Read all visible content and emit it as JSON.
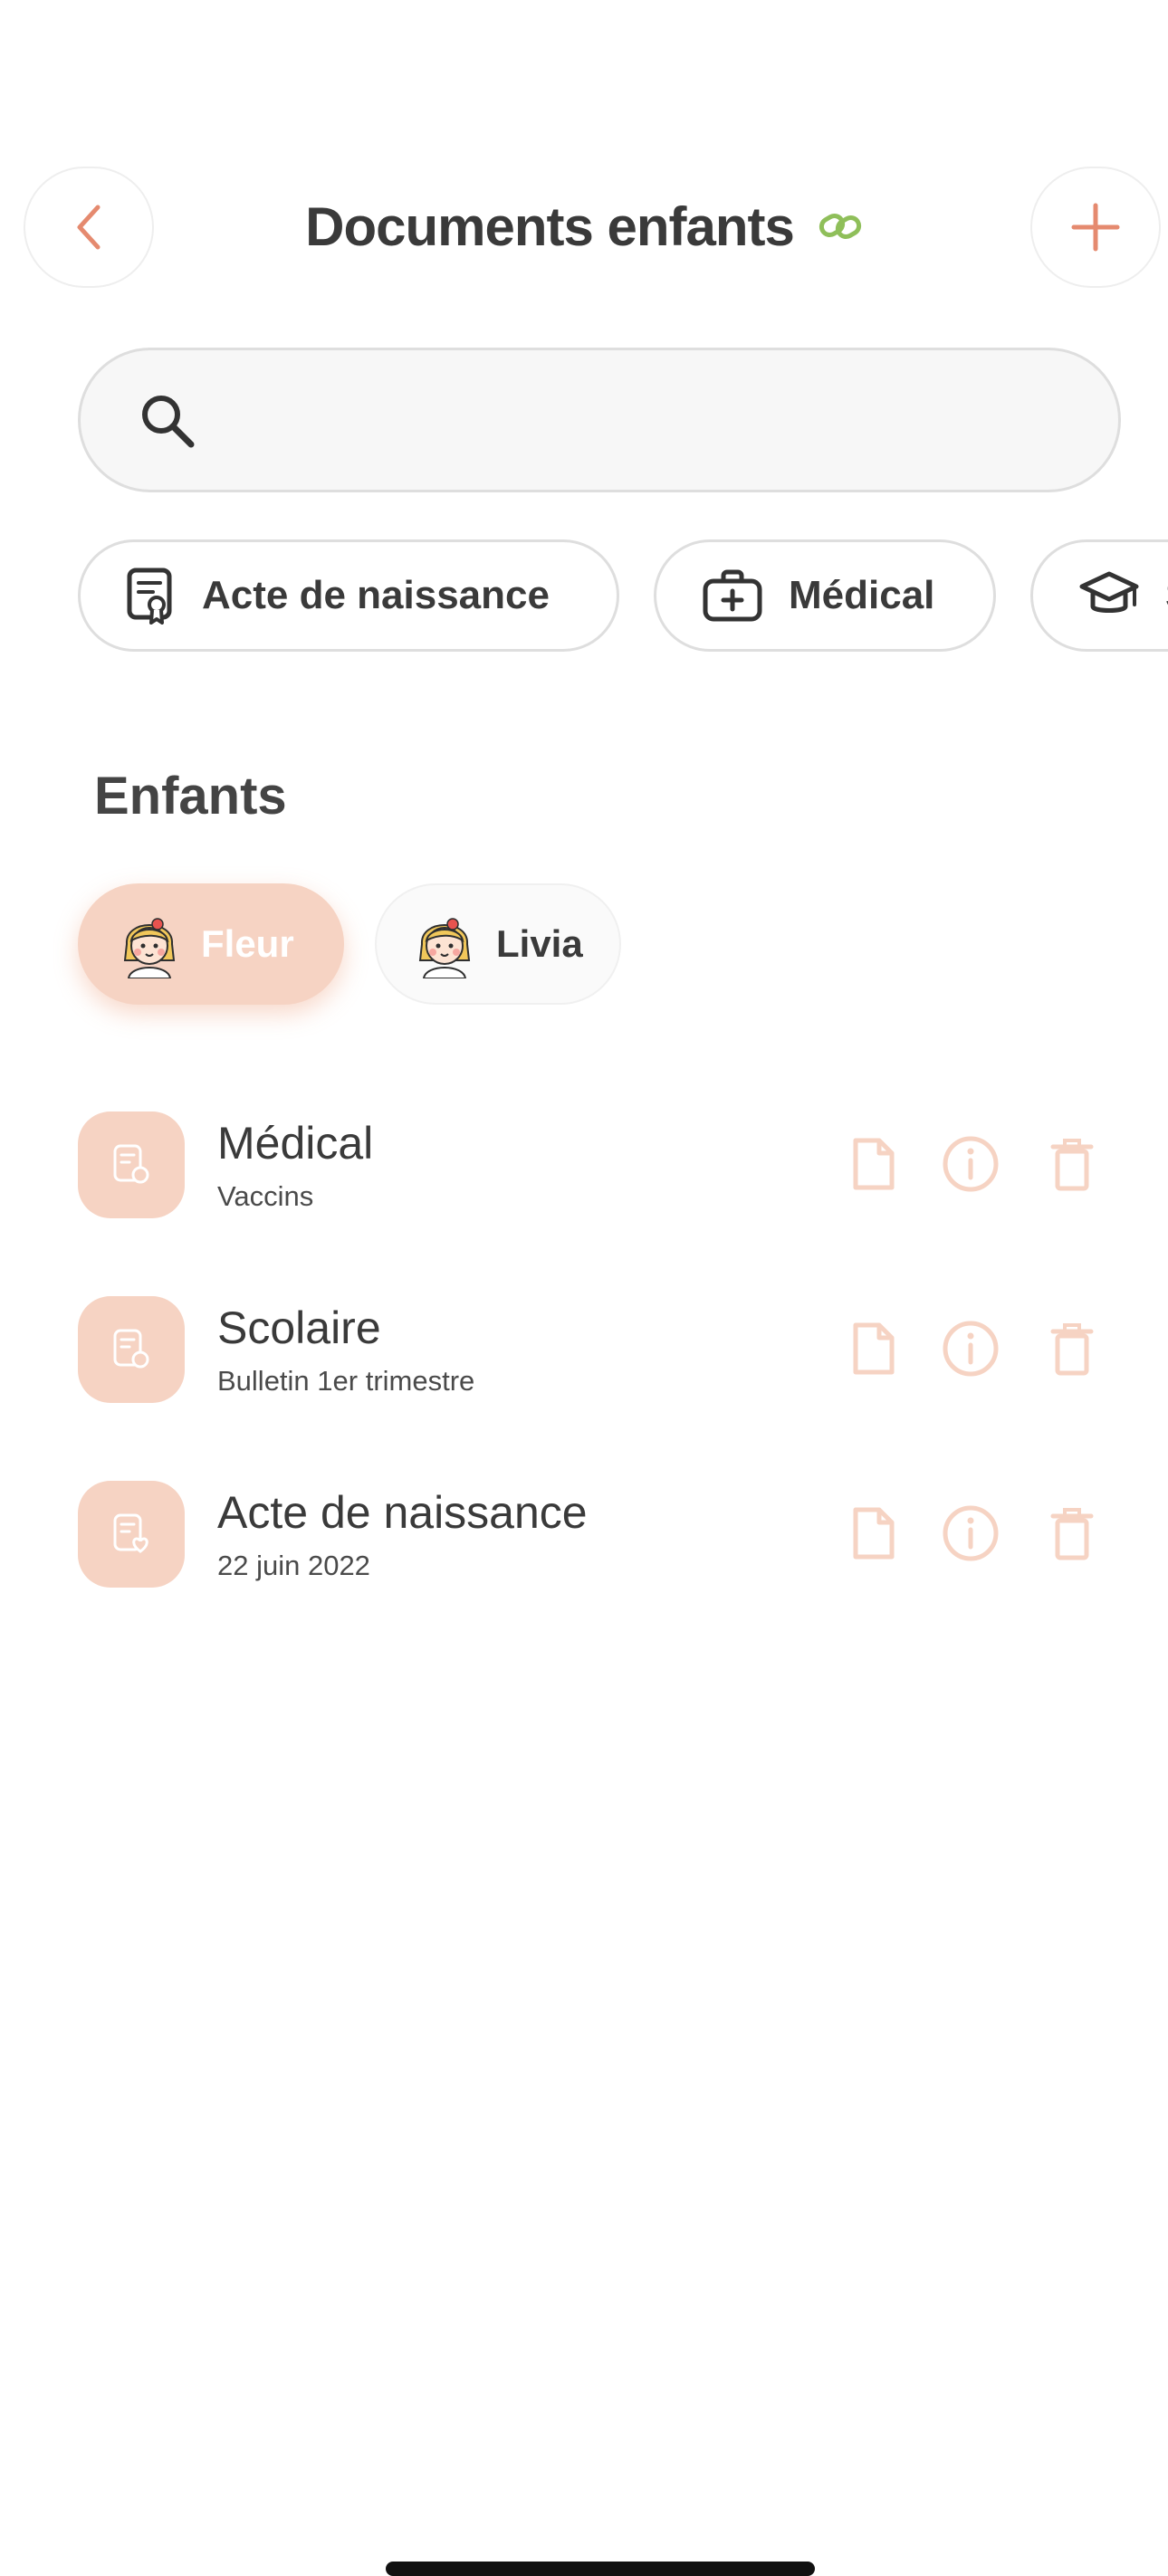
{
  "header": {
    "title": "Documents enfants",
    "back_icon": "chevron-left-icon",
    "add_icon": "plus-icon",
    "link_icon": "link-icon"
  },
  "search": {
    "placeholder": "",
    "icon": "search-icon"
  },
  "categories": [
    {
      "label": "Acte de naissance",
      "icon": "certificate-icon"
    },
    {
      "label": "Médical",
      "icon": "medical-kit-icon"
    },
    {
      "label": "S",
      "icon": "graduation-cap-icon"
    }
  ],
  "children_section": {
    "title": "Enfants",
    "children": [
      {
        "name": "Fleur",
        "selected": true
      },
      {
        "name": "Livia",
        "selected": false
      }
    ]
  },
  "documents": [
    {
      "title": "Médical",
      "subtitle": "Vaccins"
    },
    {
      "title": "Scolaire",
      "subtitle": "Bulletin 1er trimestre"
    },
    {
      "title": "Acte de naissance",
      "subtitle": "22 juin 2022"
    }
  ],
  "colors": {
    "accent": "#e58a6f",
    "peach": "#f6d3c3",
    "link_green": "#8fbf5a",
    "text": "#3a3a3a"
  }
}
